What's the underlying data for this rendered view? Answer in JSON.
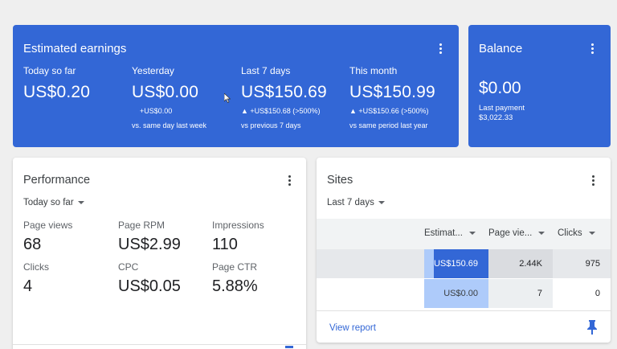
{
  "earnings": {
    "title": "Estimated earnings",
    "metrics": [
      {
        "label": "Today so far",
        "value": "US$0.20",
        "sub1": "",
        "sub2": ""
      },
      {
        "label": "Yesterday",
        "value": "US$0.00",
        "sub1": "+US$0.00",
        "sub2": "vs. same day last week"
      },
      {
        "label": "Last 7 days",
        "value": "US$150.69",
        "sub1": "▲ +US$150.68 (>500%)",
        "sub2": "vs previous 7 days"
      },
      {
        "label": "This month",
        "value": "US$150.99",
        "sub1": "▲ +US$150.66 (>500%)",
        "sub2": "vs same period last year"
      }
    ]
  },
  "balance": {
    "title": "Balance",
    "value": "$0.00",
    "last_payment_label": "Last payment",
    "last_payment_value": "$3,022.33"
  },
  "performance": {
    "title": "Performance",
    "range": "Today so far",
    "metrics": [
      {
        "label": "Page views",
        "value": "68"
      },
      {
        "label": "Page RPM",
        "value": "US$2.99"
      },
      {
        "label": "Impressions",
        "value": "110"
      },
      {
        "label": "Clicks",
        "value": "4"
      },
      {
        "label": "CPC",
        "value": "US$0.05"
      },
      {
        "label": "Page CTR",
        "value": "5.88%"
      }
    ]
  },
  "sites": {
    "title": "Sites",
    "range": "Last 7 days",
    "columns": [
      "Estimat...",
      "Page vie...",
      "Clicks"
    ],
    "rows": [
      {
        "earnings": "US$150.69",
        "page_views": "2.44K",
        "clicks": "975",
        "bar": 1.0
      },
      {
        "earnings": "US$0.00",
        "page_views": "7",
        "clicks": "0",
        "bar": 0.0
      }
    ],
    "view_report": "View report"
  },
  "colors": {
    "brand_blue": "#3367d6",
    "bar_dark": "#3367d6",
    "bar_light": "#aecbfa"
  }
}
